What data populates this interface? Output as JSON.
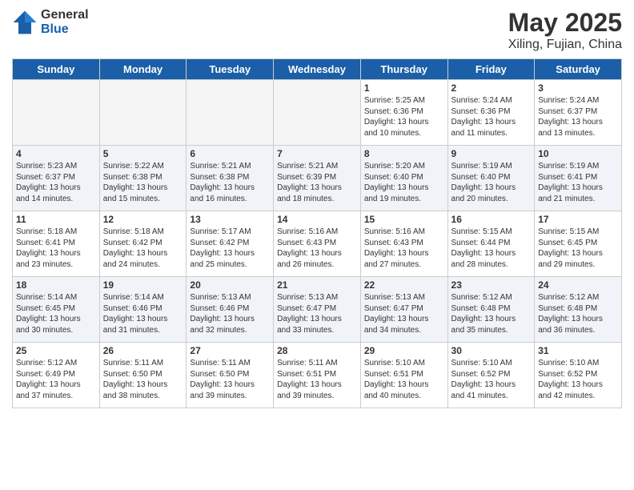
{
  "header": {
    "logo_general": "General",
    "logo_blue": "Blue",
    "month_title": "May 2025",
    "location": "Xiling, Fujian, China"
  },
  "weekdays": [
    "Sunday",
    "Monday",
    "Tuesday",
    "Wednesday",
    "Thursday",
    "Friday",
    "Saturday"
  ],
  "weeks": [
    [
      {
        "day": "",
        "info": ""
      },
      {
        "day": "",
        "info": ""
      },
      {
        "day": "",
        "info": ""
      },
      {
        "day": "",
        "info": ""
      },
      {
        "day": "1",
        "info": "Sunrise: 5:25 AM\nSunset: 6:36 PM\nDaylight: 13 hours\nand 10 minutes."
      },
      {
        "day": "2",
        "info": "Sunrise: 5:24 AM\nSunset: 6:36 PM\nDaylight: 13 hours\nand 11 minutes."
      },
      {
        "day": "3",
        "info": "Sunrise: 5:24 AM\nSunset: 6:37 PM\nDaylight: 13 hours\nand 13 minutes."
      }
    ],
    [
      {
        "day": "4",
        "info": "Sunrise: 5:23 AM\nSunset: 6:37 PM\nDaylight: 13 hours\nand 14 minutes."
      },
      {
        "day": "5",
        "info": "Sunrise: 5:22 AM\nSunset: 6:38 PM\nDaylight: 13 hours\nand 15 minutes."
      },
      {
        "day": "6",
        "info": "Sunrise: 5:21 AM\nSunset: 6:38 PM\nDaylight: 13 hours\nand 16 minutes."
      },
      {
        "day": "7",
        "info": "Sunrise: 5:21 AM\nSunset: 6:39 PM\nDaylight: 13 hours\nand 18 minutes."
      },
      {
        "day": "8",
        "info": "Sunrise: 5:20 AM\nSunset: 6:40 PM\nDaylight: 13 hours\nand 19 minutes."
      },
      {
        "day": "9",
        "info": "Sunrise: 5:19 AM\nSunset: 6:40 PM\nDaylight: 13 hours\nand 20 minutes."
      },
      {
        "day": "10",
        "info": "Sunrise: 5:19 AM\nSunset: 6:41 PM\nDaylight: 13 hours\nand 21 minutes."
      }
    ],
    [
      {
        "day": "11",
        "info": "Sunrise: 5:18 AM\nSunset: 6:41 PM\nDaylight: 13 hours\nand 23 minutes."
      },
      {
        "day": "12",
        "info": "Sunrise: 5:18 AM\nSunset: 6:42 PM\nDaylight: 13 hours\nand 24 minutes."
      },
      {
        "day": "13",
        "info": "Sunrise: 5:17 AM\nSunset: 6:42 PM\nDaylight: 13 hours\nand 25 minutes."
      },
      {
        "day": "14",
        "info": "Sunrise: 5:16 AM\nSunset: 6:43 PM\nDaylight: 13 hours\nand 26 minutes."
      },
      {
        "day": "15",
        "info": "Sunrise: 5:16 AM\nSunset: 6:43 PM\nDaylight: 13 hours\nand 27 minutes."
      },
      {
        "day": "16",
        "info": "Sunrise: 5:15 AM\nSunset: 6:44 PM\nDaylight: 13 hours\nand 28 minutes."
      },
      {
        "day": "17",
        "info": "Sunrise: 5:15 AM\nSunset: 6:45 PM\nDaylight: 13 hours\nand 29 minutes."
      }
    ],
    [
      {
        "day": "18",
        "info": "Sunrise: 5:14 AM\nSunset: 6:45 PM\nDaylight: 13 hours\nand 30 minutes."
      },
      {
        "day": "19",
        "info": "Sunrise: 5:14 AM\nSunset: 6:46 PM\nDaylight: 13 hours\nand 31 minutes."
      },
      {
        "day": "20",
        "info": "Sunrise: 5:13 AM\nSunset: 6:46 PM\nDaylight: 13 hours\nand 32 minutes."
      },
      {
        "day": "21",
        "info": "Sunrise: 5:13 AM\nSunset: 6:47 PM\nDaylight: 13 hours\nand 33 minutes."
      },
      {
        "day": "22",
        "info": "Sunrise: 5:13 AM\nSunset: 6:47 PM\nDaylight: 13 hours\nand 34 minutes."
      },
      {
        "day": "23",
        "info": "Sunrise: 5:12 AM\nSunset: 6:48 PM\nDaylight: 13 hours\nand 35 minutes."
      },
      {
        "day": "24",
        "info": "Sunrise: 5:12 AM\nSunset: 6:48 PM\nDaylight: 13 hours\nand 36 minutes."
      }
    ],
    [
      {
        "day": "25",
        "info": "Sunrise: 5:12 AM\nSunset: 6:49 PM\nDaylight: 13 hours\nand 37 minutes."
      },
      {
        "day": "26",
        "info": "Sunrise: 5:11 AM\nSunset: 6:50 PM\nDaylight: 13 hours\nand 38 minutes."
      },
      {
        "day": "27",
        "info": "Sunrise: 5:11 AM\nSunset: 6:50 PM\nDaylight: 13 hours\nand 39 minutes."
      },
      {
        "day": "28",
        "info": "Sunrise: 5:11 AM\nSunset: 6:51 PM\nDaylight: 13 hours\nand 39 minutes."
      },
      {
        "day": "29",
        "info": "Sunrise: 5:10 AM\nSunset: 6:51 PM\nDaylight: 13 hours\nand 40 minutes."
      },
      {
        "day": "30",
        "info": "Sunrise: 5:10 AM\nSunset: 6:52 PM\nDaylight: 13 hours\nand 41 minutes."
      },
      {
        "day": "31",
        "info": "Sunrise: 5:10 AM\nSunset: 6:52 PM\nDaylight: 13 hours\nand 42 minutes."
      }
    ]
  ]
}
